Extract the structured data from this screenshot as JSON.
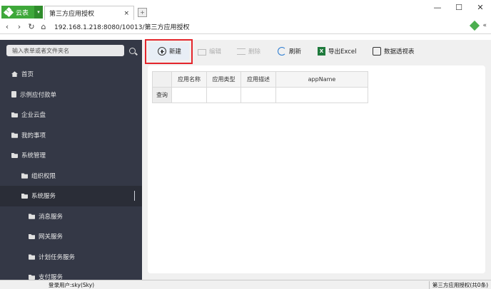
{
  "browser": {
    "app_name": "云表",
    "tab_title": "第三方应用授权",
    "tab_close": "×",
    "new_tab": "+",
    "url": "192.168.1.218:8080/10013/第三方应用授权",
    "window_controls": [
      "—",
      "☐",
      "✕"
    ],
    "nav_icons": [
      "back-icon",
      "forward-icon",
      "refresh-icon",
      "home-icon"
    ]
  },
  "sidebar": {
    "search_placeholder": "输入表单或者文件夹名",
    "items": [
      {
        "label": "首页",
        "icon": "house-icon",
        "indent": 0
      },
      {
        "label": "示例应付款单",
        "icon": "document-icon",
        "indent": 0
      },
      {
        "label": "企业云盘",
        "icon": "folder-icon",
        "indent": 0
      },
      {
        "label": "我的事项",
        "icon": "folder-icon",
        "indent": 0
      },
      {
        "label": "系统管理",
        "icon": "folder-icon",
        "indent": 0
      },
      {
        "label": "组织权限",
        "icon": "folder-icon",
        "indent": 1
      },
      {
        "label": "系统服务",
        "icon": "folder-icon",
        "indent": 1,
        "active": true
      },
      {
        "label": "消息服务",
        "icon": "folder-icon",
        "indent": 2
      },
      {
        "label": "网关服务",
        "icon": "folder-icon",
        "indent": 2
      },
      {
        "label": "计划任务服务",
        "icon": "folder-icon",
        "indent": 2
      },
      {
        "label": "支付服务",
        "icon": "folder-icon",
        "indent": 2
      }
    ]
  },
  "toolbar": {
    "new_label": "新建",
    "edit_label": "编辑",
    "delete_label": "删除",
    "refresh_label": "刷新",
    "export_label": "导出Excel",
    "pivot_label": "数据透视表",
    "excel_glyph": "X"
  },
  "grid": {
    "columns": [
      "应用名称",
      "应用类型",
      "应用描述",
      "appName"
    ],
    "row_label": "查询"
  },
  "status": {
    "user": "登录用户:sky(Sky)",
    "summary": "第三方应用授权(共0条)"
  },
  "colors": {
    "sidebar_bg": "#343846",
    "accent_green": "#3ea83a",
    "highlight_red": "#e4252b"
  }
}
